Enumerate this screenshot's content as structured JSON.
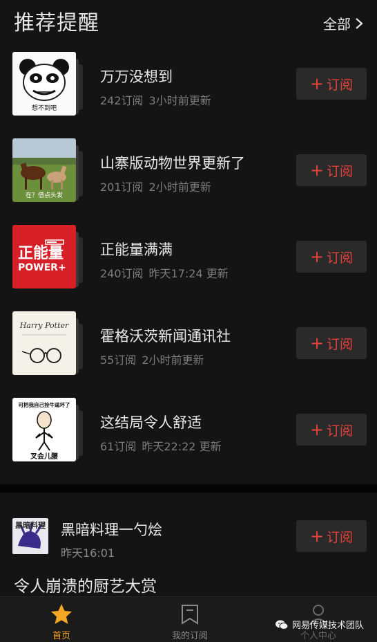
{
  "header": {
    "title": "推荐提醒",
    "all_label": "全部"
  },
  "subscribe_label": "订阅",
  "items": [
    {
      "title": "万万没想到",
      "subs": "242订阅",
      "update": "3小时前更新",
      "thumb_caption": "想不到吧"
    },
    {
      "title": "山寨版动物世界更新了",
      "subs": "201订阅",
      "update": "2小时前更新",
      "thumb_caption": "在？借点头发"
    },
    {
      "title": "正能量满满",
      "subs": "240订阅",
      "update": "昨天17:24 更新",
      "thumb_caption": "正能量 POWER+"
    },
    {
      "title": "霍格沃茨新闻通讯社",
      "subs": "55订阅",
      "update": "2小时前更新",
      "thumb_caption": "Harry Potter"
    },
    {
      "title": "这结局令人舒适",
      "subs": "61订阅",
      "update": "昨天22:22 更新",
      "thumb_caption_top": "可把我自己拴牛逼坏了",
      "thumb_caption": "叉会儿腰"
    }
  ],
  "feed": {
    "title": "黑暗料理一勺烩",
    "time": "昨天16:01",
    "headline": "令人崩溃的厨艺大赏",
    "thumb_caption": "黑暗料理"
  },
  "tabs": [
    {
      "label": "首页",
      "icon": "star-icon",
      "active": true
    },
    {
      "label": "我的订阅",
      "icon": "bookmark-icon",
      "active": false
    },
    {
      "label": "个人中心",
      "icon": "person-icon",
      "active": false
    }
  ],
  "watermark": "网易传媒技术团队",
  "colors": {
    "accent": "#e8413a",
    "active_tab": "#f5a623",
    "background": "#141414"
  }
}
